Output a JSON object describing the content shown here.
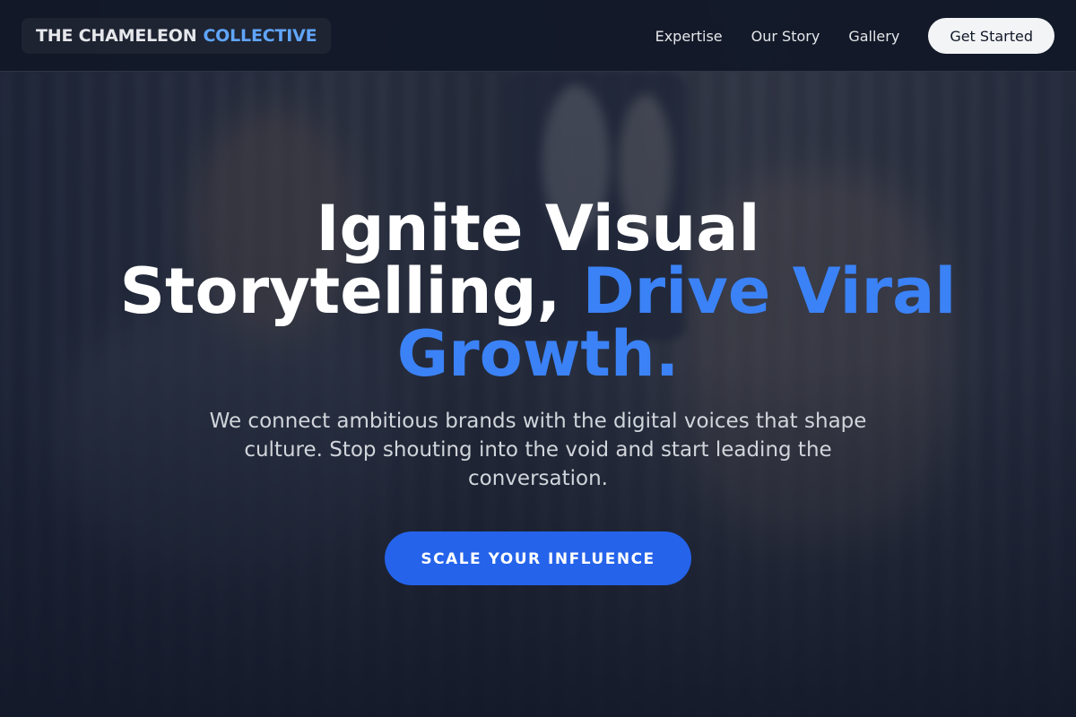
{
  "header": {
    "logo": {
      "part1": "THE CHAMELEON",
      "part2": "COLLECTIVE"
    },
    "nav": [
      {
        "label": "Expertise"
      },
      {
        "label": "Our Story"
      },
      {
        "label": "Gallery"
      }
    ],
    "cta_label": "Get Started"
  },
  "hero": {
    "headline_white": "Ignite Visual Storytelling,",
    "headline_accent": "Drive Viral Growth.",
    "subtext": "We connect ambitious brands with the digital voices that shape culture. Stop shouting into the void and start leading the conversation.",
    "button_label": "SCALE YOUR INFLUENCE"
  },
  "colors": {
    "accent": "#3b82f6",
    "button": "#2563eb",
    "header_bg": "#111827"
  }
}
